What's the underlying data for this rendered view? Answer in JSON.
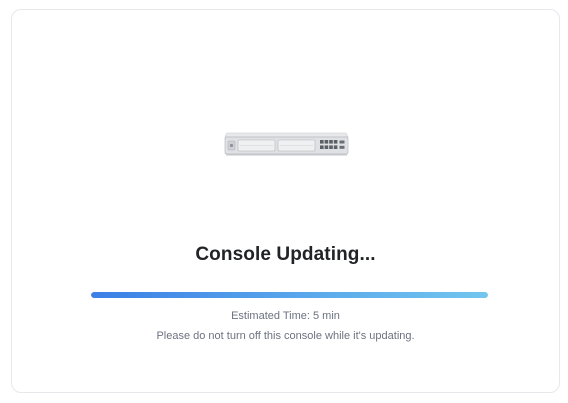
{
  "update": {
    "title": "Console Updating...",
    "estimated_time": "Estimated Time: 5 min",
    "note": "Please do not turn off this console while it's updating.",
    "progress_fraction": 1.0,
    "device_icon": "rack-console-device-image"
  },
  "colors": {
    "title": "#212327",
    "text_secondary": "#6b7280",
    "progress_start": "#3c7fe6",
    "progress_end": "#72c6ee",
    "card_border": "#e6e8ec"
  }
}
